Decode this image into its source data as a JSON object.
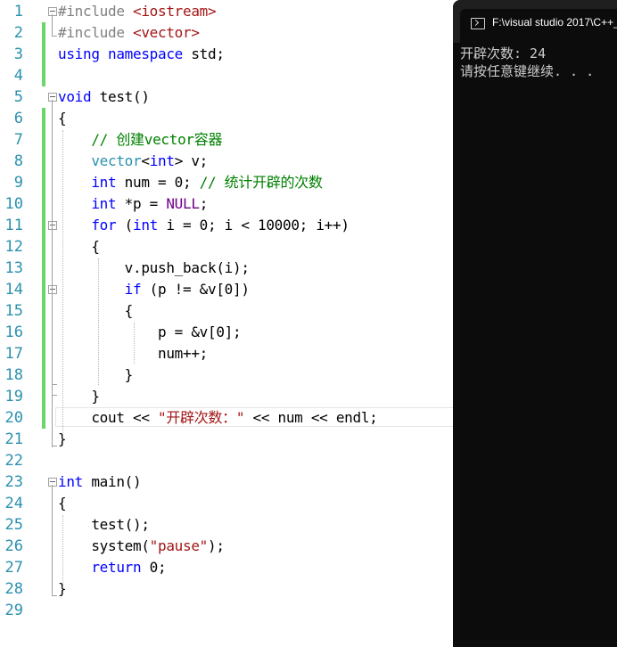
{
  "editor": {
    "lines": [
      {
        "n": "1",
        "html": "<span class=\"pp\">#include</span> <span class=\"inc\">&lt;iostream&gt;</span>"
      },
      {
        "n": "2",
        "html": "<span class=\"pp\">#include</span> <span class=\"inc\">&lt;vector&gt;</span>"
      },
      {
        "n": "3",
        "html": "<span class=\"kw\">using</span> <span class=\"kw\">namespace</span> std;"
      },
      {
        "n": "4",
        "html": ""
      },
      {
        "n": "5",
        "html": "<span class=\"kw\">void</span> test()"
      },
      {
        "n": "6",
        "html": "{"
      },
      {
        "n": "7",
        "html": "    <span class=\"cm\">// 创建vector容器</span>"
      },
      {
        "n": "8",
        "html": "    <span class=\"ty\">vector</span>&lt;<span class=\"kw\">int</span>&gt; v;"
      },
      {
        "n": "9",
        "html": "    <span class=\"kw\">int</span> num = 0; <span class=\"cm\">// 统计开辟的次数</span>"
      },
      {
        "n": "10",
        "html": "    <span class=\"kw\">int</span> *p = <span class=\"mac\">NULL</span>;"
      },
      {
        "n": "11",
        "html": "    <span class=\"kw\">for</span> (<span class=\"kw\">int</span> i = 0; i &lt; 10000; i++)"
      },
      {
        "n": "12",
        "html": "    {"
      },
      {
        "n": "13",
        "html": "        v.push_back(i);"
      },
      {
        "n": "14",
        "html": "        <span class=\"kw\">if</span> (p != &amp;v[0])"
      },
      {
        "n": "15",
        "html": "        {"
      },
      {
        "n": "16",
        "html": "            p = &amp;v[0];"
      },
      {
        "n": "17",
        "html": "            num++;"
      },
      {
        "n": "18",
        "html": "        }"
      },
      {
        "n": "19",
        "html": "    }"
      },
      {
        "n": "20",
        "html": "    cout &lt;&lt; <span class=\"st\">\"开辟次数：\"</span> &lt;&lt; num &lt;&lt; endl;"
      },
      {
        "n": "21",
        "html": "}"
      },
      {
        "n": "22",
        "html": ""
      },
      {
        "n": "23",
        "html": "<span class=\"kw\">int</span> main()"
      },
      {
        "n": "24",
        "html": "{"
      },
      {
        "n": "25",
        "html": "    test();"
      },
      {
        "n": "26",
        "html": "    system(<span class=\"st\">\"pause\"</span>);"
      },
      {
        "n": "27",
        "html": "    <span class=\"kw\">return</span> 0;"
      },
      {
        "n": "28",
        "html": "}"
      },
      {
        "n": "29",
        "html": ""
      }
    ]
  },
  "console": {
    "title": "F:\\visual studio 2017\\C++_",
    "output_line1": "开辟次数: 24",
    "output_line2": "请按任意键继续. . ."
  },
  "colors": {
    "keyword": "#0000ff",
    "comment": "#008000",
    "string": "#a31515",
    "line_number": "#2b91af",
    "change_bar": "#6cd66c"
  }
}
